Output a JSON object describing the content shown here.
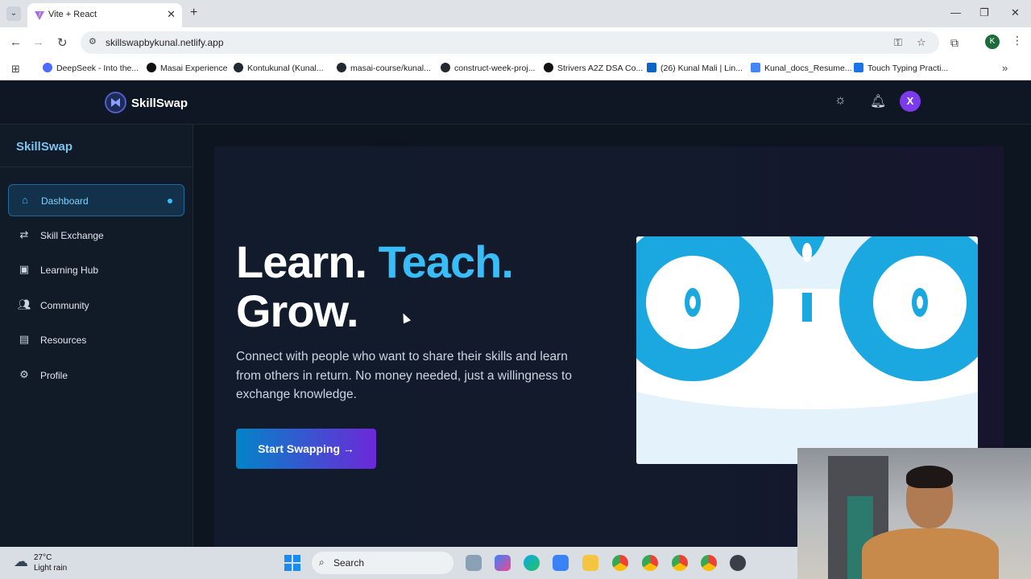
{
  "browser": {
    "tab_title": "Vite + React",
    "url": "skillswapbykunal.netlify.app",
    "profile_initial": "K",
    "bookmarks": [
      {
        "label": "DeepSeek - Into the...",
        "color": "#4d6bfe"
      },
      {
        "label": "Masai Experience",
        "color": "#111111"
      },
      {
        "label": "Kontukunal (Kunal...",
        "color": "#24292f"
      },
      {
        "label": "masai-course/kunal...",
        "color": "#24292f"
      },
      {
        "label": "construct-week-proj...",
        "color": "#24292f"
      },
      {
        "label": "Strivers A2Z DSA Co...",
        "color": "#111111"
      },
      {
        "label": "(26) Kunal Mali | Lin...",
        "color": "#0a66c2"
      },
      {
        "label": "Kunal_docs_Resume...",
        "color": "#4285f4"
      },
      {
        "label": "Touch Typing Practi...",
        "color": "#1a73e8"
      }
    ]
  },
  "header": {
    "brand": "SkillSwap",
    "avatar_initial": "X",
    "icons": [
      "sun-icon",
      "bell-icon"
    ]
  },
  "sidebar": {
    "title": "SkillSwap",
    "items": [
      {
        "label": "Dashboard",
        "icon": "home-icon",
        "active": true
      },
      {
        "label": "Skill Exchange",
        "icon": "exchange-icon",
        "active": false
      },
      {
        "label": "Learning Hub",
        "icon": "learning-icon",
        "active": false
      },
      {
        "label": "Community",
        "icon": "community-icon",
        "active": false
      },
      {
        "label": "Resources",
        "icon": "document-icon",
        "active": false
      },
      {
        "label": "Profile",
        "icon": "gear-icon",
        "active": false
      }
    ]
  },
  "hero": {
    "line1_a": "Learn.",
    "line1_b": "Teach.",
    "line2": "Grow.",
    "subtitle": "Connect with people who want to share their skills and learn from others in return. No money needed, just a willingness to exchange knowledge.",
    "cta": "Start Swapping →"
  },
  "colors": {
    "accent": "#38bdf8",
    "cta_start": "#0284c7",
    "cta_end": "#6d28d9",
    "avatar": "#7c3aed"
  },
  "taskbar": {
    "temperature": "27°C",
    "condition": "Light rain",
    "search": "Search"
  }
}
